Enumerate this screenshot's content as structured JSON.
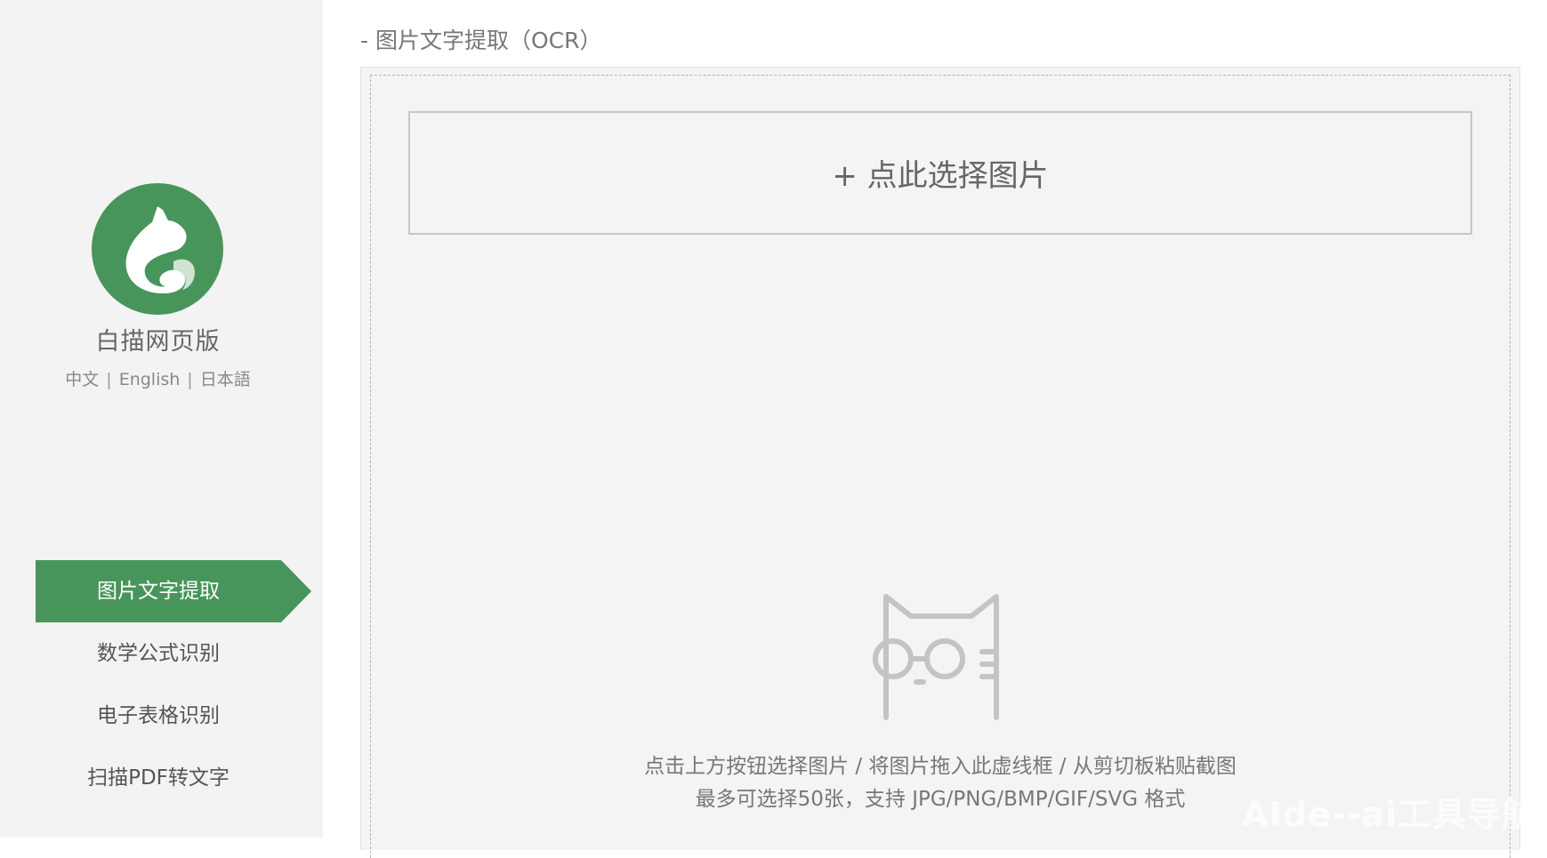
{
  "sidebar": {
    "app_name": "白描网页版",
    "languages": [
      "中文",
      "English",
      "日本語"
    ],
    "separator": "|",
    "nav": [
      {
        "label": "图片文字提取",
        "active": true
      },
      {
        "label": "数学公式识别",
        "active": false
      },
      {
        "label": "电子表格识别",
        "active": false
      },
      {
        "label": "扫描PDF转文字",
        "active": false
      }
    ]
  },
  "main": {
    "title": "- 图片文字提取（OCR）",
    "select_button": "+ 点此选择图片",
    "hint_line1": "点击上方按钮选择图片 / 将图片拖入此虚线框 / 从剪切板粘贴截图",
    "hint_line2": "最多可选择50张，支持 JPG/PNG/BMP/GIF/SVG 格式"
  },
  "watermark": "AIde--ai工具导航",
  "colors": {
    "accent": "#47955a",
    "sidebar_bg": "#f3f3f3",
    "drop_bg": "#f4f4f4"
  },
  "icons": {
    "logo": "baimiao-cat-logo-icon",
    "mascot": "cat-with-glasses-icon"
  }
}
